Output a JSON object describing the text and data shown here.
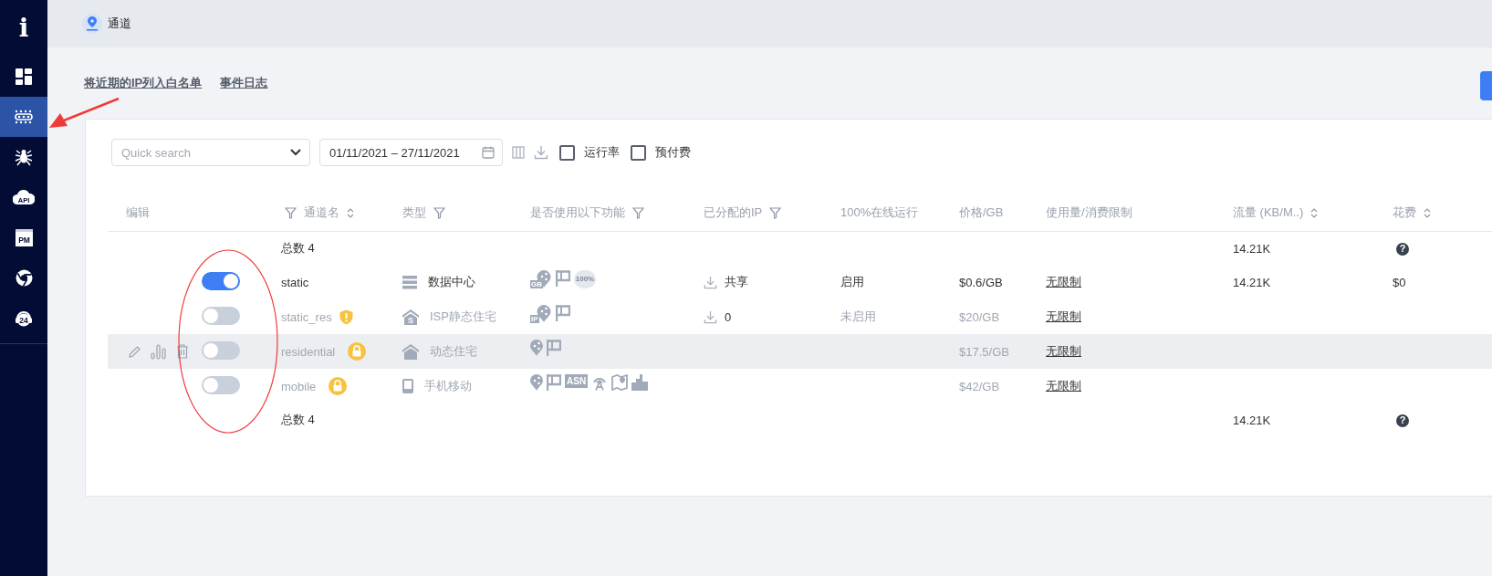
{
  "sidebar": {
    "logo": "i",
    "items": [
      {
        "kind": "dashboard",
        "selected": false
      },
      {
        "kind": "channels",
        "selected": true
      },
      {
        "kind": "spider",
        "selected": false
      },
      {
        "kind": "api-cloud",
        "text": "API",
        "selected": false
      },
      {
        "kind": "pm-window",
        "text": "PM",
        "selected": false
      },
      {
        "kind": "browser",
        "selected": false
      },
      {
        "kind": "headset",
        "text": "24",
        "selected": false
      }
    ]
  },
  "breadcrumb": {
    "title": "通道"
  },
  "links": [
    "将近期的IP列入白名单",
    "事件日志"
  ],
  "toolbar": {
    "search": {
      "placeholder": "Quick search"
    },
    "date_range": "01/11/2021 – 27/11/2021",
    "checkboxes": [
      {
        "label": "运行率",
        "checked": false
      },
      {
        "label": "预付费",
        "checked": false
      }
    ]
  },
  "table": {
    "columns": [
      {
        "label": "编辑"
      },
      {
        "label": "通道名",
        "filter": true,
        "sort": true
      },
      {
        "label": "类型",
        "filter": true
      },
      {
        "label": "是否使用以下功能",
        "filter": true
      },
      {
        "label": "已分配的IP",
        "filter": true
      },
      {
        "label": "100%在线运行"
      },
      {
        "label": "价格/GB"
      },
      {
        "label": "使用量/消费限制"
      },
      {
        "label": "流量 (KB/M..)",
        "sort": true
      },
      {
        "label": "花费",
        "sort": true
      }
    ],
    "top_total": {
      "label": "总数 4",
      "traffic": "14.21K",
      "help": "?"
    },
    "rows": [
      {
        "enabled": true,
        "highlighted": false,
        "name": "static",
        "type": {
          "kind": "server",
          "text": "数据中心"
        },
        "features": [
          {
            "kind": "share-badge",
            "text": "GB"
          },
          {
            "kind": "flag"
          },
          {
            "kind": "seal",
            "text": "100%"
          }
        ],
        "ip": "共享",
        "online": "启用",
        "price": "$0.6/GB",
        "limit": "无限制",
        "traffic": "14.21K",
        "cost": "$0"
      },
      {
        "enabled": false,
        "highlighted": false,
        "name": "static_res",
        "badge": {
          "kind": "warning"
        },
        "type": {
          "kind": "house",
          "icon_text": "S",
          "text": "ISP静态住宅"
        },
        "features": [
          {
            "kind": "share-badge",
            "text": "IP"
          },
          {
            "kind": "flag"
          }
        ],
        "ip": "0",
        "online": "未启用",
        "price": "$20/GB",
        "limit": "无限制"
      },
      {
        "enabled": false,
        "highlighted": true,
        "name": "residential",
        "badge": {
          "kind": "lock"
        },
        "type": {
          "kind": "house",
          "text": "动态住宅"
        },
        "features": [
          {
            "kind": "pin"
          },
          {
            "kind": "flag"
          }
        ],
        "price": "$17.5/GB",
        "limit": "无限制"
      },
      {
        "enabled": false,
        "highlighted": false,
        "name": "mobile",
        "badge": {
          "kind": "lock"
        },
        "type": {
          "kind": "phone",
          "text": "手机移动"
        },
        "features": [
          {
            "kind": "pin"
          },
          {
            "kind": "flag"
          },
          {
            "kind": "label",
            "text": "ASN"
          },
          {
            "kind": "antenna"
          },
          {
            "kind": "map"
          },
          {
            "kind": "building"
          }
        ],
        "price": "$42/GB",
        "limit": "无限制"
      }
    ],
    "bottom_total": {
      "label": "总数 4",
      "traffic": "14.21K",
      "help": "?"
    }
  }
}
